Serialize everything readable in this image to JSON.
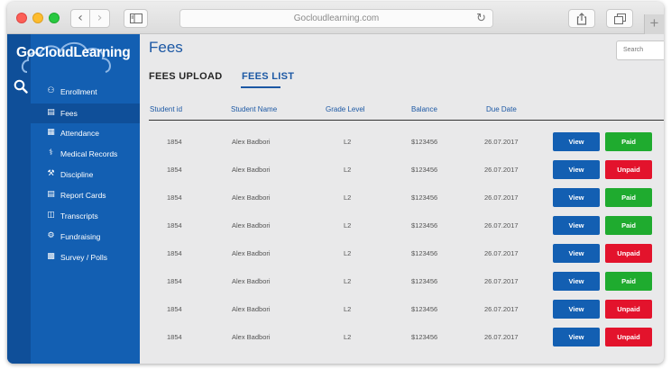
{
  "browser": {
    "url": "Gocloudlearning.com",
    "back_glyph": "‹",
    "forward_glyph": "›",
    "reload_glyph": "↻",
    "new_tab_glyph": "+"
  },
  "sidebar": {
    "logo_text": "GoCloudLearning",
    "items": [
      {
        "label": "Enrollment",
        "icon": "people-icon",
        "active": false
      },
      {
        "label": "Fees",
        "icon": "card-icon",
        "active": true
      },
      {
        "label": "Attendance",
        "icon": "calendar-icon",
        "active": false
      },
      {
        "label": "Medical Records",
        "icon": "stethoscope-icon",
        "active": false
      },
      {
        "label": "Discipline",
        "icon": "gavel-icon",
        "active": false
      },
      {
        "label": "Report Cards",
        "icon": "report-icon",
        "active": false
      },
      {
        "label": "Transcripts",
        "icon": "book-icon",
        "active": false
      },
      {
        "label": "Fundraising",
        "icon": "fundraising-icon",
        "active": false
      },
      {
        "label": "Survey / Polls",
        "icon": "poll-icon",
        "active": false
      }
    ]
  },
  "main": {
    "title": "Fees",
    "search_placeholder": "Search",
    "tabs": {
      "upload": "FEES UPLOAD",
      "list": "FEES LIST",
      "active": "list"
    },
    "columns": {
      "student_id": "Student id",
      "student_name": "Student Name",
      "grade": "Grade Level",
      "balance": "Balance",
      "due_date": "Due Date"
    },
    "view_label": "View",
    "paid_label": "Paid",
    "unpaid_label": "Unpaid",
    "rows": [
      {
        "id": "1854",
        "name": "Alex Badbori",
        "grade": "L2",
        "balance": "$123456",
        "due": "26.07.2017",
        "status": "Paid"
      },
      {
        "id": "1854",
        "name": "Alex Badbori",
        "grade": "L2",
        "balance": "$123456",
        "due": "26.07.2017",
        "status": "Unpaid"
      },
      {
        "id": "1854",
        "name": "Alex Badbori",
        "grade": "L2",
        "balance": "$123456",
        "due": "26.07.2017",
        "status": "Paid"
      },
      {
        "id": "1854",
        "name": "Alex Badbori",
        "grade": "L2",
        "balance": "$123456",
        "due": "26.07.2017",
        "status": "Paid"
      },
      {
        "id": "1854",
        "name": "Alex Badbori",
        "grade": "L2",
        "balance": "$123456",
        "due": "26.07.2017",
        "status": "Unpaid"
      },
      {
        "id": "1854",
        "name": "Alex Badbori",
        "grade": "L2",
        "balance": "$123456",
        "due": "26.07.2017",
        "status": "Paid"
      },
      {
        "id": "1854",
        "name": "Alex Badbori",
        "grade": "L2",
        "balance": "$123456",
        "due": "26.07.2017",
        "status": "Unpaid"
      },
      {
        "id": "1854",
        "name": "Alex Badbori",
        "grade": "L2",
        "balance": "$123456",
        "due": "26.07.2017",
        "status": "Unpaid"
      }
    ]
  },
  "colors": {
    "sidebar": "#135fb2",
    "accent": "#1c58a4",
    "paid": "#1fab2f",
    "unpaid": "#e3132c"
  }
}
